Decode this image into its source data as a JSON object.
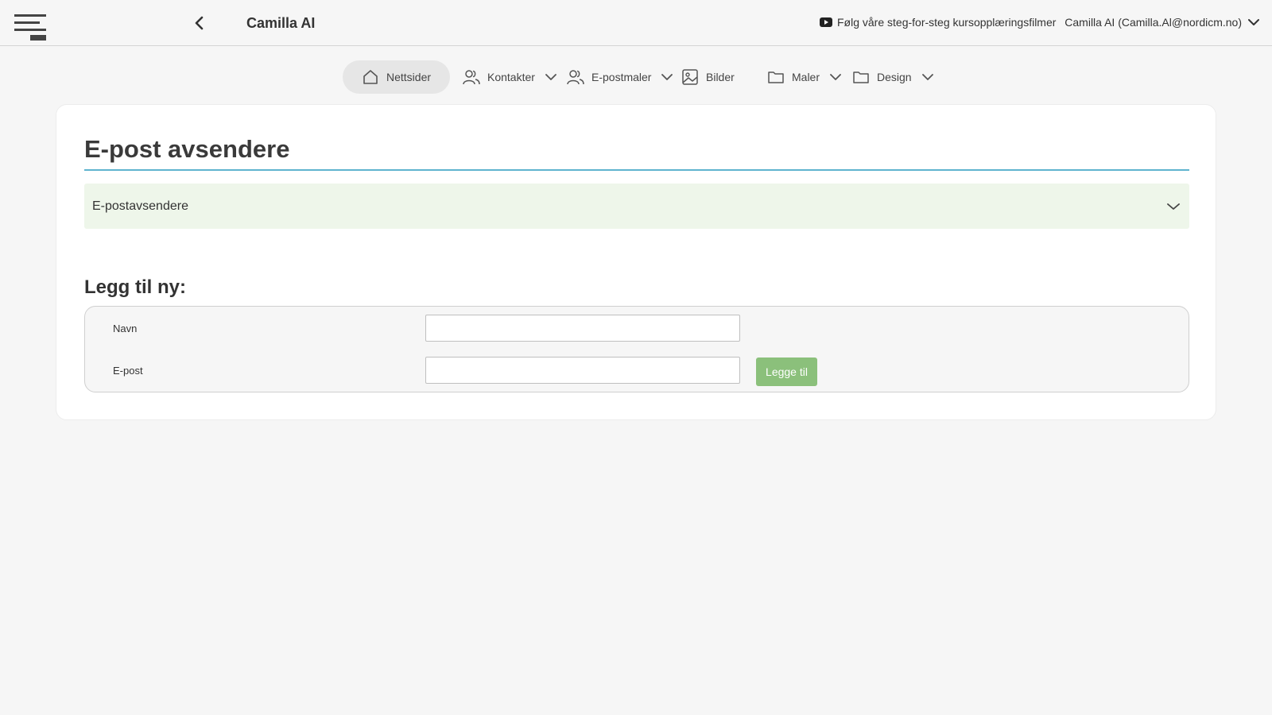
{
  "app": {
    "title": "Camilla AI"
  },
  "header": {
    "tutorial_link": "Følg våre steg-for-steg kursopplæringsfilmer",
    "user_label": "Camilla AI (Camilla.Al@nordicm.no)"
  },
  "nav": {
    "items": [
      {
        "label": "Nettsider",
        "icon": "home-icon",
        "active": true
      },
      {
        "label": "Kontakter",
        "icon": "users-icon",
        "dropdown": true
      },
      {
        "label": "E-postmaler",
        "icon": "users-icon",
        "dropdown": true
      },
      {
        "label": "Bilder",
        "icon": "image-icon"
      },
      {
        "label": "Maler",
        "icon": "folder-icon",
        "dropdown": true
      },
      {
        "label": "Design",
        "icon": "folder-icon",
        "dropdown": true
      }
    ]
  },
  "main": {
    "title": "E-post avsendere",
    "accordion_label": "E-postavsendere",
    "add_heading": "Legg til ny:",
    "form": {
      "name_label": "Navn",
      "name_value": "",
      "email_label": "E-post",
      "email_value": "",
      "submit_label": "Legge til"
    }
  },
  "colors": {
    "accent_rule": "#5fb4cf",
    "accordion_bg": "#eef6ea",
    "add_button": "#8bc07b",
    "active_nav_bg": "#e6e6e6"
  }
}
